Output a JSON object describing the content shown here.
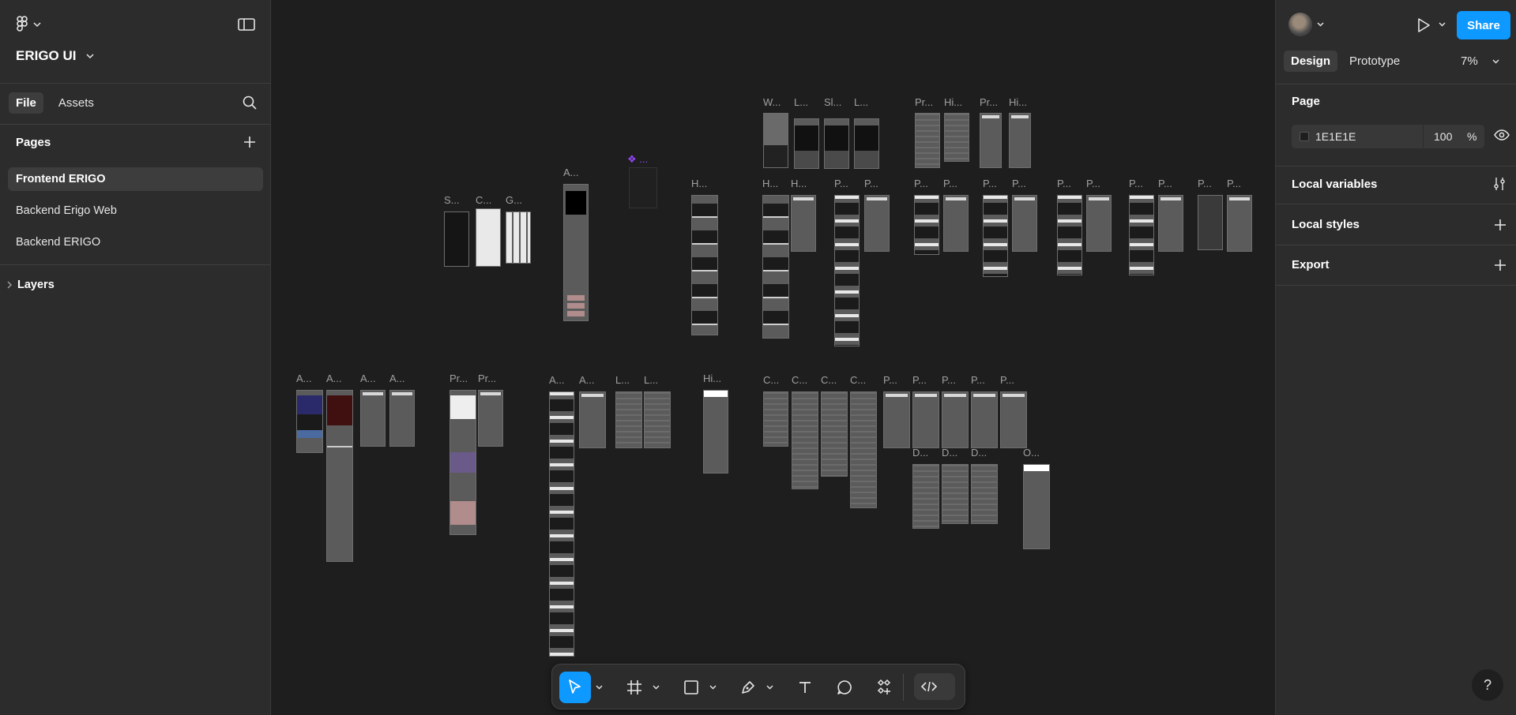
{
  "file": {
    "name": "ERIGO UI"
  },
  "left_panel": {
    "tabs": [
      "File",
      "Assets"
    ],
    "pages_title": "Pages",
    "pages": [
      "Frontend ERIGO",
      "Backend Erigo Web",
      "Backend ERIGO"
    ],
    "layers_title": "Layers"
  },
  "canvas": {
    "background": "#1E1E1E",
    "frame_labels": {
      "s": "S...",
      "c": "C...",
      "g": "G...",
      "a": "A...",
      "h": "H...",
      "w": "W...",
      "l": "L...",
      "sl": "Sl...",
      "pr": "Pr...",
      "hi": "Hi...",
      "p": "P...",
      "d": "D...",
      "o": "O..."
    }
  },
  "toolbar": {
    "tools": [
      "move-tool",
      "frame-tool",
      "shape-tool",
      "pen-tool",
      "text-tool",
      "comment-tool",
      "actions-tool",
      "dev-mode-toggle"
    ]
  },
  "right_panel": {
    "tabs": [
      "Design",
      "Prototype"
    ],
    "zoom": "7%",
    "share_label": "Share",
    "page_section": "Page",
    "page_color": "1E1E1E",
    "page_opacity": "100",
    "page_opacity_unit": "%",
    "sections": [
      "Local variables",
      "Local styles",
      "Export"
    ],
    "help": "?"
  }
}
